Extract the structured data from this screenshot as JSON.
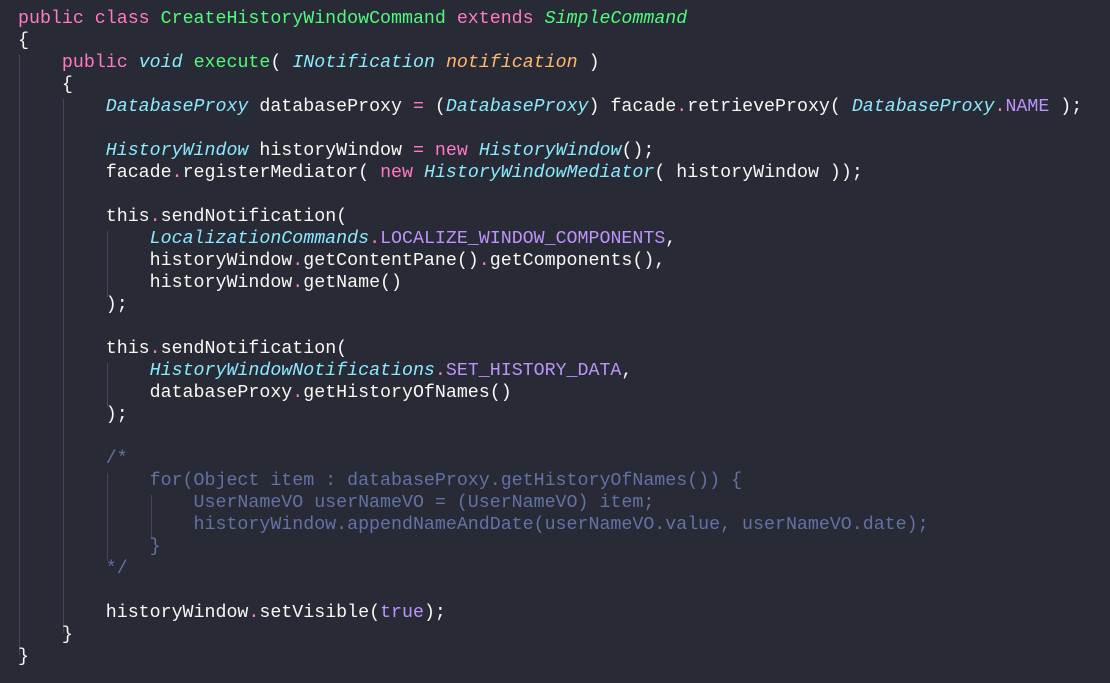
{
  "theme": {
    "background": "#282a36",
    "foreground": "#f8f8f2",
    "keyword": "#ff79c6",
    "class_name": "#50fa7b",
    "type": "#8be9fd",
    "parameter": "#ffb86c",
    "constant": "#bd93f9",
    "comment": "#6272a4",
    "indent_guide": "#44475a"
  },
  "lines": [
    [
      {
        "t": "public class ",
        "c": "kw"
      },
      {
        "t": "CreateHistoryWindowCommand",
        "c": "cls"
      },
      {
        "t": " extends ",
        "c": "kw"
      },
      {
        "t": "SimpleCommand",
        "c": "sup"
      }
    ],
    [
      {
        "t": "{",
        "c": "p"
      }
    ],
    [
      {
        "t": "    ",
        "c": "p"
      },
      {
        "t": "public",
        "c": "kw"
      },
      {
        "t": " ",
        "c": "p"
      },
      {
        "t": "void",
        "c": "type"
      },
      {
        "t": " ",
        "c": "p"
      },
      {
        "t": "execute",
        "c": "fn"
      },
      {
        "t": "( ",
        "c": "p"
      },
      {
        "t": "INotification",
        "c": "type"
      },
      {
        "t": " ",
        "c": "p"
      },
      {
        "t": "notification",
        "c": "param"
      },
      {
        "t": " )",
        "c": "p"
      }
    ],
    [
      {
        "t": "    {",
        "c": "p"
      }
    ],
    [
      {
        "t": "        ",
        "c": "p"
      },
      {
        "t": "DatabaseProxy",
        "c": "type"
      },
      {
        "t": " databaseProxy ",
        "c": "p"
      },
      {
        "t": "=",
        "c": "op"
      },
      {
        "t": " (",
        "c": "p"
      },
      {
        "t": "DatabaseProxy",
        "c": "type"
      },
      {
        "t": ") facade",
        "c": "p"
      },
      {
        "t": ".",
        "c": "op"
      },
      {
        "t": "retrieveProxy( ",
        "c": "p"
      },
      {
        "t": "DatabaseProxy",
        "c": "type"
      },
      {
        "t": ".",
        "c": "op"
      },
      {
        "t": "NAME",
        "c": "const"
      },
      {
        "t": " );",
        "c": "p"
      }
    ],
    [
      {
        "t": "",
        "c": "p"
      }
    ],
    [
      {
        "t": "        ",
        "c": "p"
      },
      {
        "t": "HistoryWindow",
        "c": "type"
      },
      {
        "t": " historyWindow ",
        "c": "p"
      },
      {
        "t": "=",
        "c": "op"
      },
      {
        "t": " ",
        "c": "p"
      },
      {
        "t": "new",
        "c": "kw"
      },
      {
        "t": " ",
        "c": "p"
      },
      {
        "t": "HistoryWindow",
        "c": "type"
      },
      {
        "t": "();",
        "c": "p"
      }
    ],
    [
      {
        "t": "        facade",
        "c": "p"
      },
      {
        "t": ".",
        "c": "op"
      },
      {
        "t": "registerMediator( ",
        "c": "p"
      },
      {
        "t": "new",
        "c": "kw"
      },
      {
        "t": " ",
        "c": "p"
      },
      {
        "t": "HistoryWindowMediator",
        "c": "type"
      },
      {
        "t": "( historyWindow ));",
        "c": "p"
      }
    ],
    [
      {
        "t": "",
        "c": "p"
      }
    ],
    [
      {
        "t": "        this",
        "c": "p"
      },
      {
        "t": ".",
        "c": "op"
      },
      {
        "t": "sendNotification(",
        "c": "p"
      }
    ],
    [
      {
        "t": "            ",
        "c": "p"
      },
      {
        "t": "LocalizationCommands",
        "c": "type"
      },
      {
        "t": ".",
        "c": "op"
      },
      {
        "t": "LOCALIZE_WINDOW_COMPONENTS",
        "c": "const"
      },
      {
        "t": ",",
        "c": "p"
      }
    ],
    [
      {
        "t": "            historyWindow",
        "c": "p"
      },
      {
        "t": ".",
        "c": "op"
      },
      {
        "t": "getContentPane()",
        "c": "p"
      },
      {
        "t": ".",
        "c": "op"
      },
      {
        "t": "getComponents(),",
        "c": "p"
      }
    ],
    [
      {
        "t": "            historyWindow",
        "c": "p"
      },
      {
        "t": ".",
        "c": "op"
      },
      {
        "t": "getName()",
        "c": "p"
      }
    ],
    [
      {
        "t": "        );",
        "c": "p"
      }
    ],
    [
      {
        "t": "",
        "c": "p"
      }
    ],
    [
      {
        "t": "        this",
        "c": "p"
      },
      {
        "t": ".",
        "c": "op"
      },
      {
        "t": "sendNotification(",
        "c": "p"
      }
    ],
    [
      {
        "t": "            ",
        "c": "p"
      },
      {
        "t": "HistoryWindowNotifications",
        "c": "type"
      },
      {
        "t": ".",
        "c": "op"
      },
      {
        "t": "SET_HISTORY_DATA",
        "c": "const"
      },
      {
        "t": ",",
        "c": "p"
      }
    ],
    [
      {
        "t": "            databaseProxy",
        "c": "p"
      },
      {
        "t": ".",
        "c": "op"
      },
      {
        "t": "getHistoryOfNames()",
        "c": "p"
      }
    ],
    [
      {
        "t": "        );",
        "c": "p"
      }
    ],
    [
      {
        "t": "",
        "c": "p"
      }
    ],
    [
      {
        "t": "        /*",
        "c": "cm"
      }
    ],
    [
      {
        "t": "            for(Object item : databaseProxy.getHistoryOfNames()) {",
        "c": "cm"
      }
    ],
    [
      {
        "t": "                UserNameVO userNameVO = (UserNameVO) item;",
        "c": "cm"
      }
    ],
    [
      {
        "t": "                historyWindow.appendNameAndDate(userNameVO.value, userNameVO.date);",
        "c": "cm"
      }
    ],
    [
      {
        "t": "            }",
        "c": "cm"
      }
    ],
    [
      {
        "t": "        */",
        "c": "cm"
      }
    ],
    [
      {
        "t": "",
        "c": "p"
      }
    ],
    [
      {
        "t": "        historyWindow",
        "c": "p"
      },
      {
        "t": ".",
        "c": "op"
      },
      {
        "t": "setVisible(",
        "c": "p"
      },
      {
        "t": "true",
        "c": "const"
      },
      {
        "t": ");",
        "c": "p"
      }
    ],
    [
      {
        "t": "    }",
        "c": "p"
      }
    ],
    [
      {
        "t": "}",
        "c": "p"
      }
    ]
  ]
}
